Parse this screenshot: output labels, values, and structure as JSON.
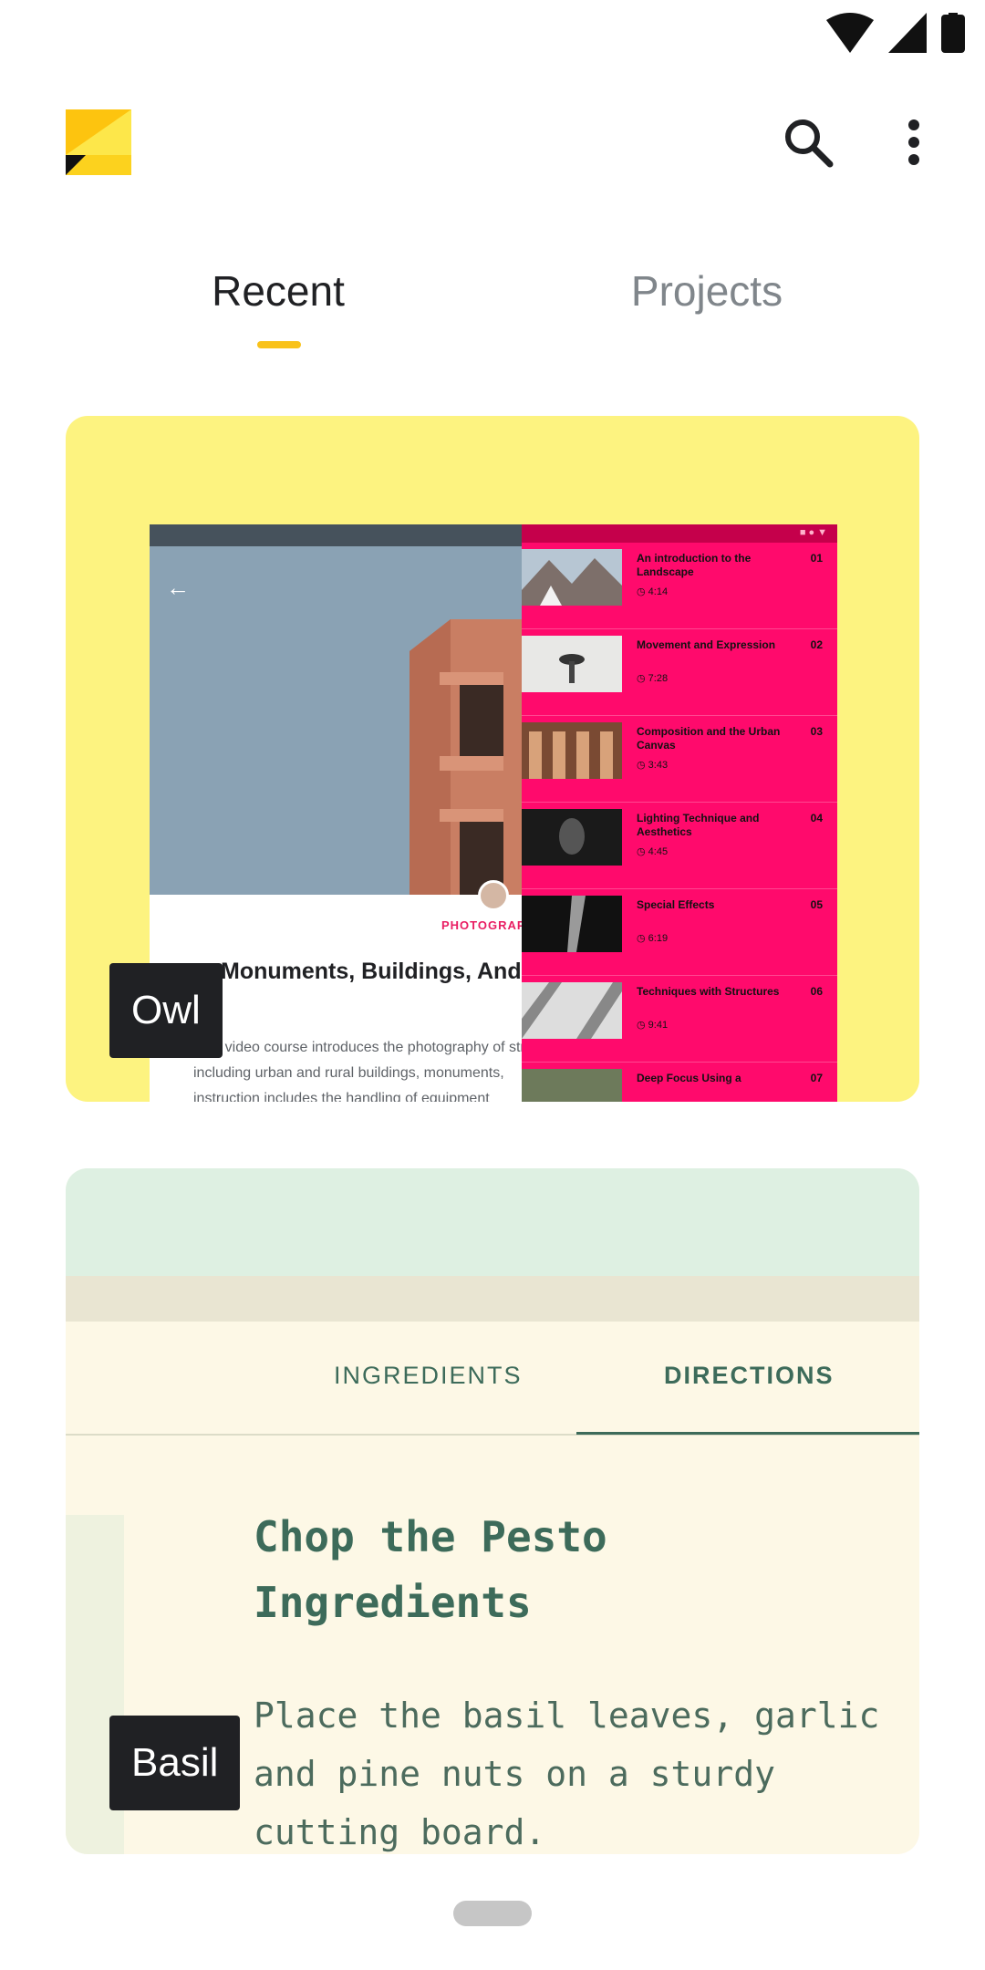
{
  "status_bar": {
    "wifi_icon": "wifi-icon",
    "signal_icon": "cell-signal-icon",
    "battery_icon": "battery-icon"
  },
  "app_bar": {
    "logo_icon": "app-logo-icon",
    "search_icon": "search-icon",
    "more_icon": "more-vert-icon"
  },
  "tabs": [
    {
      "label": "Recent",
      "selected": true
    },
    {
      "label": "Projects",
      "selected": false
    }
  ],
  "colors": {
    "accent": "#f9c21a",
    "owl_card_bg": "#fdf380",
    "owl_pink": "#ff0a6c",
    "basil_card_bg": "#fdf8e6",
    "basil_green": "#3d6b5a"
  },
  "cards": {
    "owl": {
      "label": "Owl",
      "preview": {
        "category": "PHOTOGRAPHY",
        "course_title": "Monuments, Buildings, And Other Structures",
        "description_lines": [
          "This video course introduces the photography of structures,",
          "including urban and rural buildings, monuments,",
          "instruction includes the handling of equipment"
        ],
        "lessons": [
          {
            "title": "An introduction to the Landscape",
            "time": "4:14",
            "num": "01"
          },
          {
            "title": "Movement and Expression",
            "time": "7:28",
            "num": "02"
          },
          {
            "title": "Composition and the Urban Canvas",
            "time": "3:43",
            "num": "03"
          },
          {
            "title": "Lighting Technique and Aesthetics",
            "time": "4:45",
            "num": "04"
          },
          {
            "title": "Special Effects",
            "time": "6:19",
            "num": "05"
          },
          {
            "title": "Techniques with Structures",
            "time": "9:41",
            "num": "06"
          },
          {
            "title": "Deep Focus Using a",
            "time": "",
            "num": "07"
          }
        ]
      }
    },
    "basil": {
      "label": "Basil",
      "preview": {
        "tab_ingredients": "INGREDIENTS",
        "tab_directions": "DIRECTIONS",
        "heading": "Chop the Pesto Ingredients",
        "body": "Place the basil leaves, garlic and pine nuts on a sturdy cutting board."
      }
    }
  }
}
